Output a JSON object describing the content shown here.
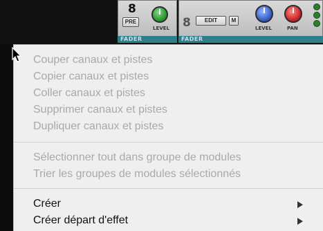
{
  "mixer": {
    "strip1": {
      "number": "8",
      "pre_label": "PRE",
      "level_label": "LEVEL",
      "fader_label": "FADER"
    },
    "strip2": {
      "number": "8",
      "edit_label": "EDIT",
      "m_label": "M",
      "level_label": "LEVEL",
      "pan_label": "PAN",
      "fader_label": "FADER"
    }
  },
  "menu": {
    "group1": [
      {
        "label": "Couper canaux et pistes",
        "enabled": false
      },
      {
        "label": "Copier canaux et pistes",
        "enabled": false
      },
      {
        "label": "Coller canaux et pistes",
        "enabled": false
      },
      {
        "label": "Supprimer canaux et pistes",
        "enabled": false
      },
      {
        "label": "Dupliquer canaux et pistes",
        "enabled": false
      }
    ],
    "group2": [
      {
        "label": "Sélectionner tout dans groupe de modules",
        "enabled": false
      },
      {
        "label": "Trier les groupes de modules sélectionnés",
        "enabled": false
      }
    ],
    "group3": [
      {
        "label": "Créer",
        "enabled": true,
        "submenu": true
      },
      {
        "label": "Créer départ d'effet",
        "enabled": true,
        "submenu": true
      }
    ]
  },
  "colors": {
    "menu_background": "#efefef",
    "disabled_text": "#a9a9a9",
    "enabled_text": "#111111",
    "fader_bar": "#2f7f8a",
    "level_knob_green": "#2e9a3a",
    "level_knob_blue": "#3a63c8",
    "pan_knob_red": "#cc2a2a"
  },
  "icons": [
    "mouse-pointer-icon",
    "submenu-arrow-icon",
    "knob-icon",
    "led-icon"
  ]
}
